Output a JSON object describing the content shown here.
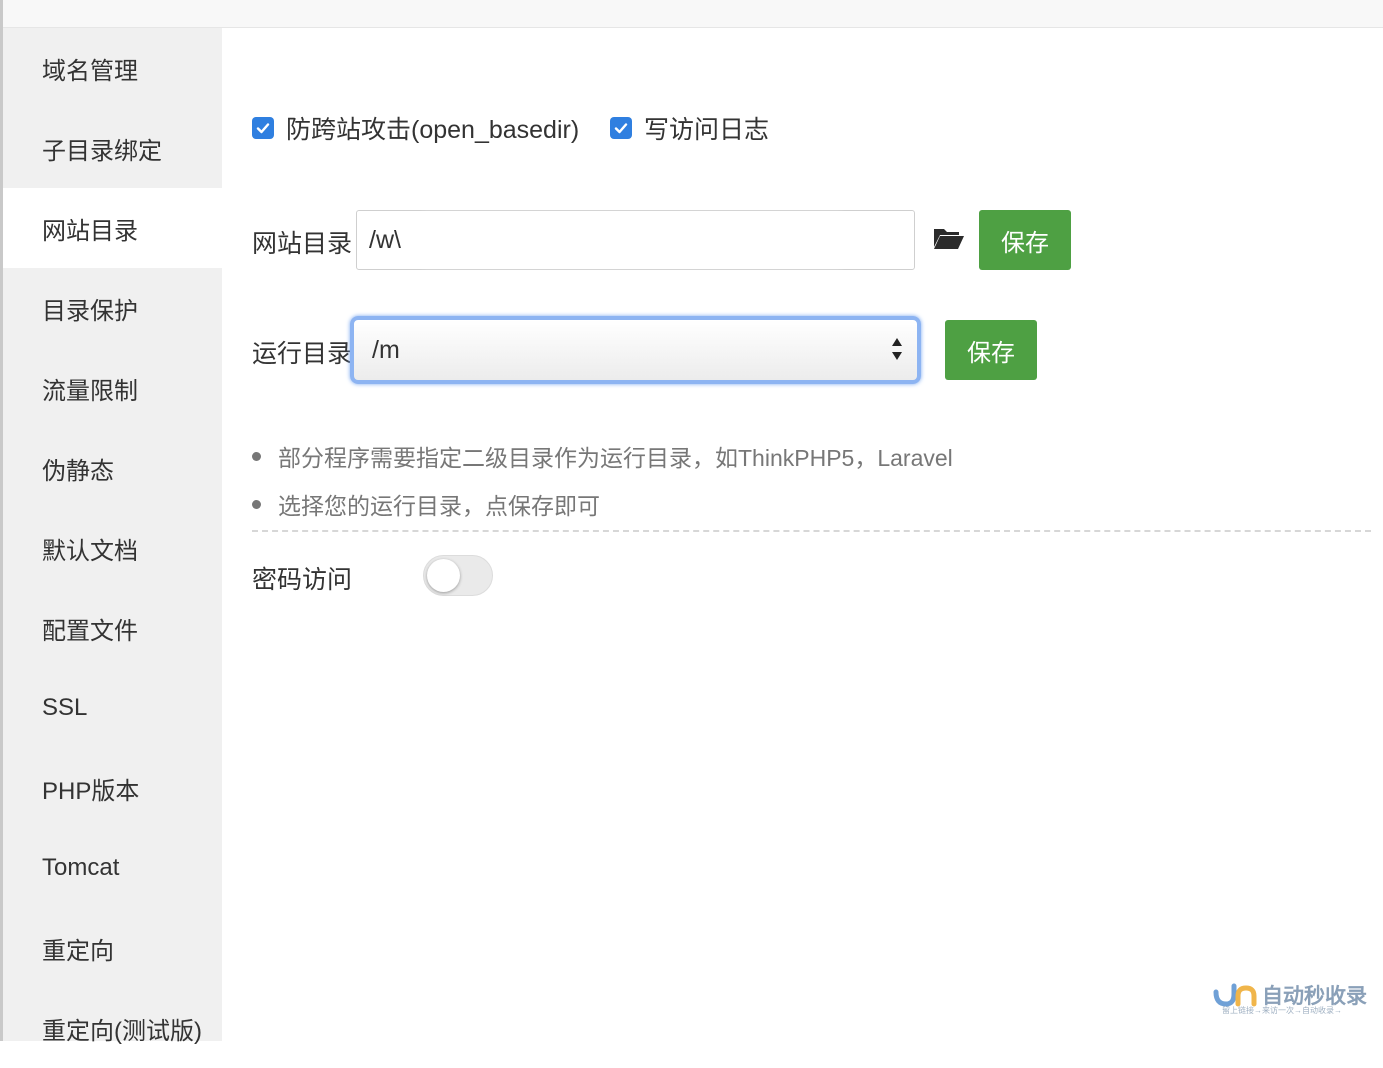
{
  "sidebar": {
    "items": [
      {
        "label": "域名管理",
        "active": false
      },
      {
        "label": "子目录绑定",
        "active": false
      },
      {
        "label": "网站目录",
        "active": true
      },
      {
        "label": "目录保护",
        "active": false
      },
      {
        "label": "流量限制",
        "active": false
      },
      {
        "label": "伪静态",
        "active": false
      },
      {
        "label": "默认文档",
        "active": false
      },
      {
        "label": "配置文件",
        "active": false
      },
      {
        "label": "SSL",
        "active": false
      },
      {
        "label": "PHP版本",
        "active": false
      },
      {
        "label": "Tomcat",
        "active": false
      },
      {
        "label": "重定向",
        "active": false
      },
      {
        "label": "重定向(测试版)",
        "active": false
      }
    ]
  },
  "options": {
    "anti_xss": {
      "label": "防跨站攻击(open_basedir)",
      "checked": true
    },
    "access_log": {
      "label": "写访问日志",
      "checked": true
    }
  },
  "site_dir": {
    "label": "网站目录",
    "value": "/w\\",
    "folder_icon": "folder-open-icon",
    "save_label": "保存"
  },
  "run_dir": {
    "label": "运行目录",
    "selected": "/m",
    "save_label": "保存"
  },
  "tips": [
    "部分程序需要指定二级目录作为运行目录，如ThinkPHP5，Laravel",
    "选择您的运行目录，点保存即可"
  ],
  "password_access": {
    "label": "密码访问",
    "enabled": false
  },
  "watermark": {
    "text": "自动秒收录",
    "subtext": "留上链接→来访一次→自动收录→"
  },
  "colors": {
    "accent": "#2f7fe0",
    "button": "#4ea043",
    "sidebar_bg": "#f0f0f0"
  }
}
